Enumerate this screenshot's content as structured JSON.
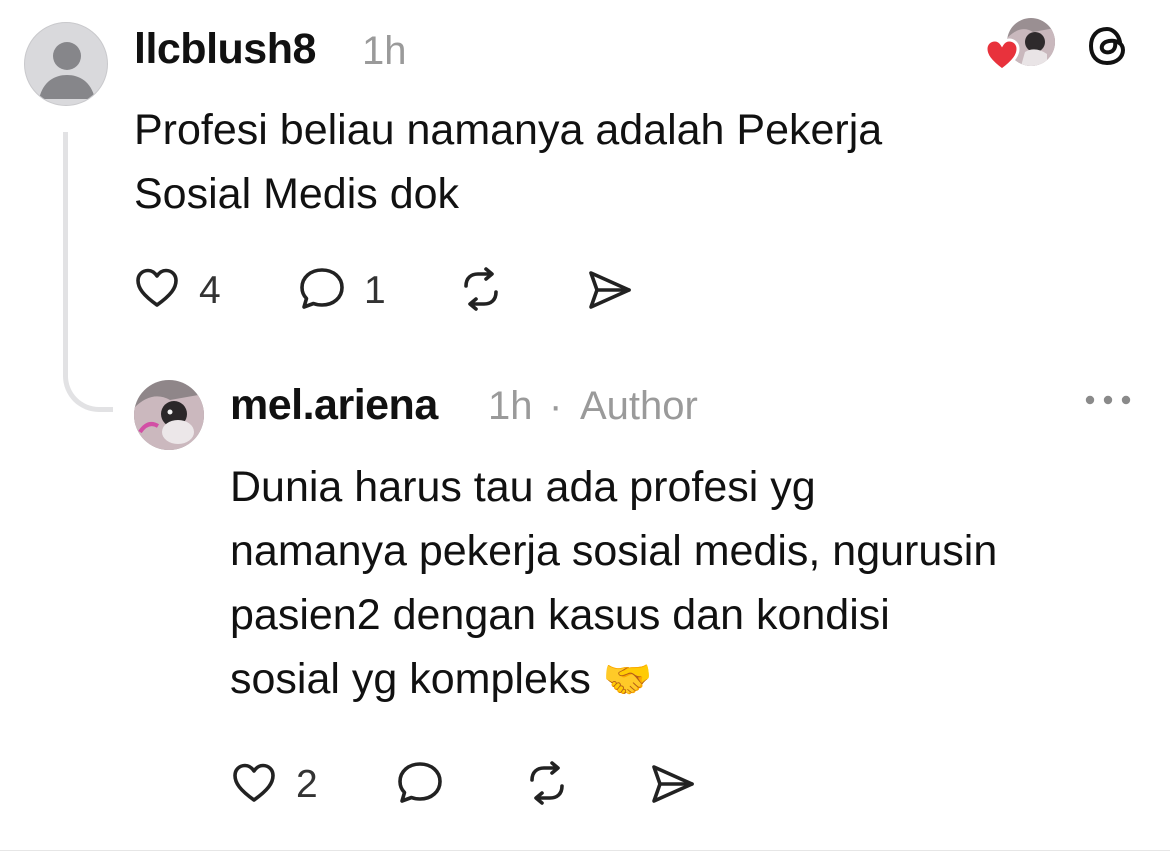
{
  "post": {
    "username": "llcblush8",
    "time": "1h",
    "text": "Profesi beliau namanya adalah Pekerja\nSosial Medis dok",
    "likes": "4",
    "replies": "1"
  },
  "reply": {
    "username": "mel.ariena",
    "time": "1h",
    "separator": "·",
    "author_tag": "Author",
    "text": "Dunia harus tau ada profesi yg\nnamanya pekerja sosial medis, ngurusin\npasien2 dengan kasus dan kondisi\nsosial yg kompleks",
    "emoji": "🤝",
    "likes": "2"
  },
  "colors": {
    "heart_red": "#e8323c",
    "muted_gray": "#9a9a9a",
    "thread_line": "#e2e2e4"
  },
  "icons": [
    "threads-logo-icon",
    "heart-icon",
    "comment-icon",
    "repost-icon",
    "share-icon",
    "more-options-icon"
  ]
}
